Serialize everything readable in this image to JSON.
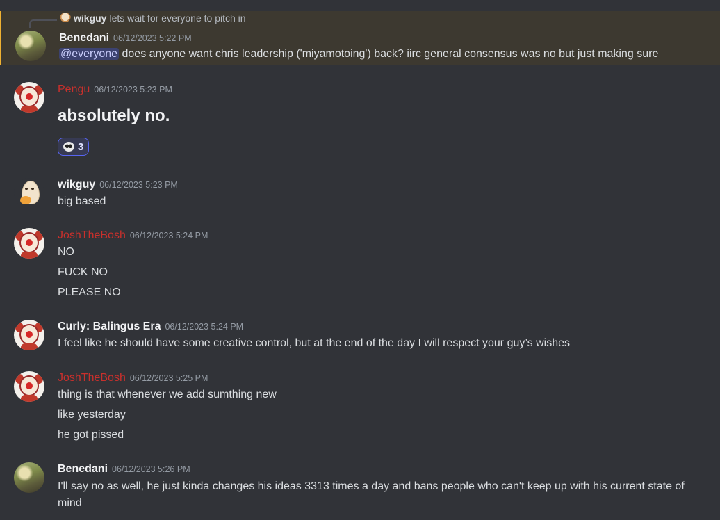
{
  "messages": [
    {
      "reply": {
        "author": "wikguy",
        "text": "lets wait for everyone to pitch in"
      },
      "author": "Benedani",
      "timestamp": "06/12/2023 5:22 PM",
      "mention": "@everyone",
      "text": " does anyone want chris leadership ('miyamotoing') back? iirc general consensus was no but just making sure",
      "avatar": "landscape-avatar",
      "highlighted": true
    },
    {
      "author": "Pengu",
      "author_color": "#c9302c",
      "timestamp": "06/12/2023 5:23 PM",
      "text": "absolutely no.",
      "reaction": {
        "emoji": "trollface-emoji",
        "count": "3"
      },
      "avatar": "clown-avatar"
    },
    {
      "author": "wikguy",
      "timestamp": "06/12/2023 5:23 PM",
      "lines": [
        "big based"
      ],
      "avatar": "egg-thinking-avatar"
    },
    {
      "author": "JoshTheBosh",
      "author_color": "#c9302c",
      "timestamp": "06/12/2023 5:24 PM",
      "lines": [
        "NO",
        "FUCK NO",
        "PLEASE NO"
      ],
      "avatar": "clown-avatar"
    },
    {
      "author": "Curly: Balingus Era",
      "timestamp": "06/12/2023 5:24 PM",
      "lines": [
        "I feel like he should have some creative control, but at the end of the day I will respect your guy’s wishes"
      ],
      "avatar": "clown-avatar"
    },
    {
      "author": "JoshTheBosh",
      "author_color": "#c9302c",
      "timestamp": "06/12/2023 5:25 PM",
      "lines": [
        "thing is that whenever we add sumthing new",
        "like yesterday",
        "he got pissed"
      ],
      "avatar": "clown-avatar"
    },
    {
      "author": "Benedani",
      "timestamp": "06/12/2023 5:26 PM",
      "lines": [
        "I'll say no as well, he just kinda changes his ideas 3313 times a day and bans people who can't keep up with his current state of mind"
      ],
      "avatar": "landscape-avatar"
    }
  ]
}
